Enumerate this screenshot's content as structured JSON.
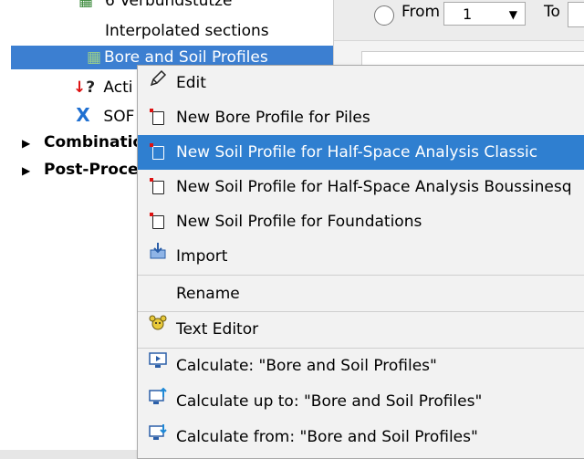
{
  "tree": {
    "items": [
      {
        "label": "6 Verbundstütze",
        "icon": "grid-icon"
      },
      {
        "label": "Interpolated sections",
        "icon": ""
      },
      {
        "label": "Bore and Soil Profiles",
        "icon": "bore-profile-icon"
      },
      {
        "label": "Acti",
        "icon": "question-icon"
      },
      {
        "label": "SOF",
        "icon": "x-icon"
      },
      {
        "label": "Combinatio",
        "icon": ""
      },
      {
        "label": "Post-Proces",
        "icon": ""
      }
    ]
  },
  "right": {
    "from_label": "From",
    "from_value": "1",
    "to_label": "To"
  },
  "menu": {
    "items": [
      {
        "label": "Edit",
        "icon": "pencil-icon"
      },
      {
        "label": "New Bore Profile for Piles",
        "icon": "new-doc-icon"
      },
      {
        "label": "New Soil Profile for Half-Space Analysis Classic",
        "icon": "new-doc-icon"
      },
      {
        "label": "New Soil Profile for Half-Space Analysis Boussinesq",
        "icon": "new-doc-icon"
      },
      {
        "label": "New Soil Profile for Foundations",
        "icon": "new-doc-icon"
      },
      {
        "label": "Import",
        "icon": "import-icon"
      },
      {
        "label": "Rename",
        "icon": ""
      },
      {
        "label": "Text Editor",
        "icon": "teddy-icon"
      },
      {
        "label": "Calculate: \"Bore and Soil Profiles\"",
        "icon": "calculate-icon"
      },
      {
        "label": "Calculate up to: \"Bore and Soil Profiles\"",
        "icon": "calculate-up-icon"
      },
      {
        "label": "Calculate from: \"Bore and Soil Profiles\"",
        "icon": "calculate-from-icon"
      }
    ]
  },
  "colors": {
    "selection": "#3c7fd1",
    "menu_highlight": "#2f7fd0"
  }
}
